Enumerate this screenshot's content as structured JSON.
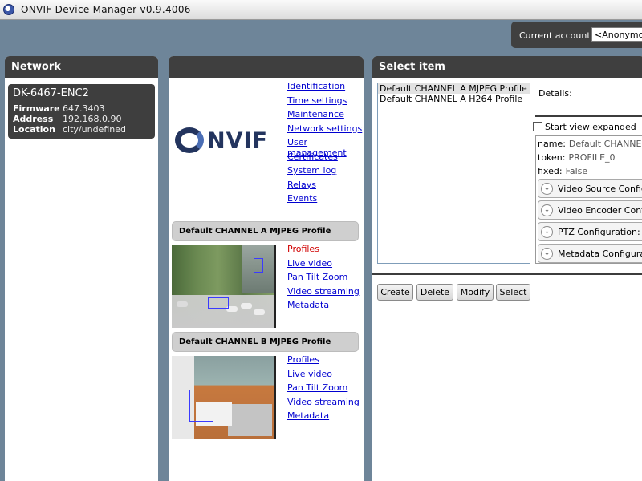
{
  "window": {
    "title": "ONVIF Device Manager v0.9.4006"
  },
  "account": {
    "label": "Current account:",
    "value": "<Anonymous>"
  },
  "network": {
    "title": "Network",
    "device": {
      "name": "DK-6467-ENC2",
      "firmware_label": "Firmware",
      "firmware": "647.3403",
      "address_label": "Address",
      "address": "192.168.0.90",
      "location_label": "Location",
      "location": "city/undefined"
    }
  },
  "device_panel": {
    "logo_text": "NVIF",
    "device_links": [
      "Identification",
      "Time settings",
      "Maintenance",
      "Network settings",
      "User management",
      "Certificates",
      "System log",
      "Relays",
      "Events"
    ],
    "profiles": [
      {
        "title": "Default CHANNEL A MJPEG Profile",
        "links": [
          "Profiles",
          "Live video",
          "Pan Tilt Zoom",
          "Video streaming",
          "Metadata"
        ]
      },
      {
        "title": "Default CHANNEL B MJPEG Profile",
        "links": [
          "Profiles",
          "Live video",
          "Pan Tilt Zoom",
          "Video streaming",
          "Metadata"
        ]
      }
    ]
  },
  "select_item": {
    "title": "Select item",
    "items": [
      "Default CHANNEL A MJPEG Profile",
      "Default CHANNEL A H264 Profile"
    ],
    "details_label": "Details:",
    "start_expanded_label": "Start view expanded",
    "name_label": "name:",
    "name_value": "Default CHANNEL A",
    "token_label": "token:",
    "token_value": "PROFILE_0",
    "fixed_label": "fixed:",
    "fixed_value": "False",
    "configs": [
      "Video Source Configur",
      "Video Encoder Configu",
      "PTZ Configuration:  F",
      "Metadata Configuration"
    ],
    "buttons": [
      "Create",
      "Delete",
      "Modify",
      "Select"
    ]
  }
}
